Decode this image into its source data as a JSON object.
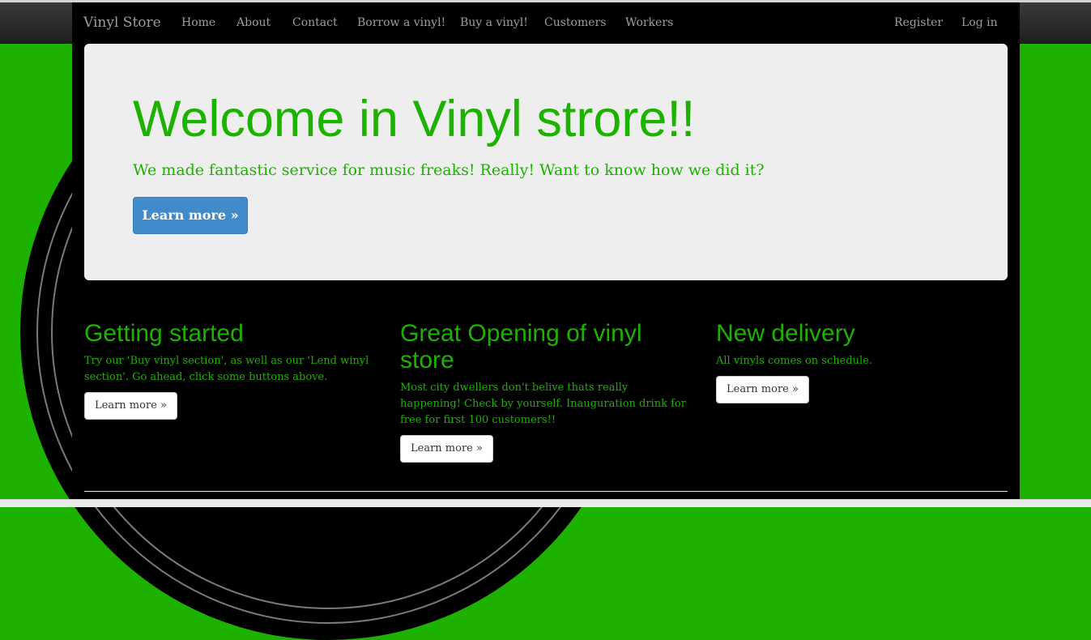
{
  "navbar": {
    "brand": "Vinyl Store",
    "links": [
      "Home",
      "About",
      "Contact",
      "Borrow a vinyl!",
      "Buy a vinyl!",
      "Customers",
      "Workers"
    ],
    "right_links": [
      "Register",
      "Log in"
    ]
  },
  "jumbotron": {
    "title": "Welcome in Vinyl strore!!",
    "subtitle": "We made fantastic service for music freaks! Really! Want to know how we did it?",
    "button": "Learn more »"
  },
  "columns": [
    {
      "heading": "Getting started",
      "text": "Try our 'Buy vinyl section', as well as our 'Lend winyl section'. Go ahead, click some buttons above.",
      "button": "Learn more »"
    },
    {
      "heading": "Great Opening of vinyl store",
      "text": "Most city dwellers don't belive thats really happening! Check by yourself. Inauguration drink for free for first 100 customers!!",
      "button": "Learn more »"
    },
    {
      "heading": "New delivery",
      "text": "All vinyls comes on schedule.",
      "button": "Learn more »"
    }
  ],
  "colors": {
    "accent": "#1db100",
    "primary_button": "#428bca",
    "navbar_text": "#9d9d9d",
    "jumbotron_bg": "#eeeeee"
  }
}
